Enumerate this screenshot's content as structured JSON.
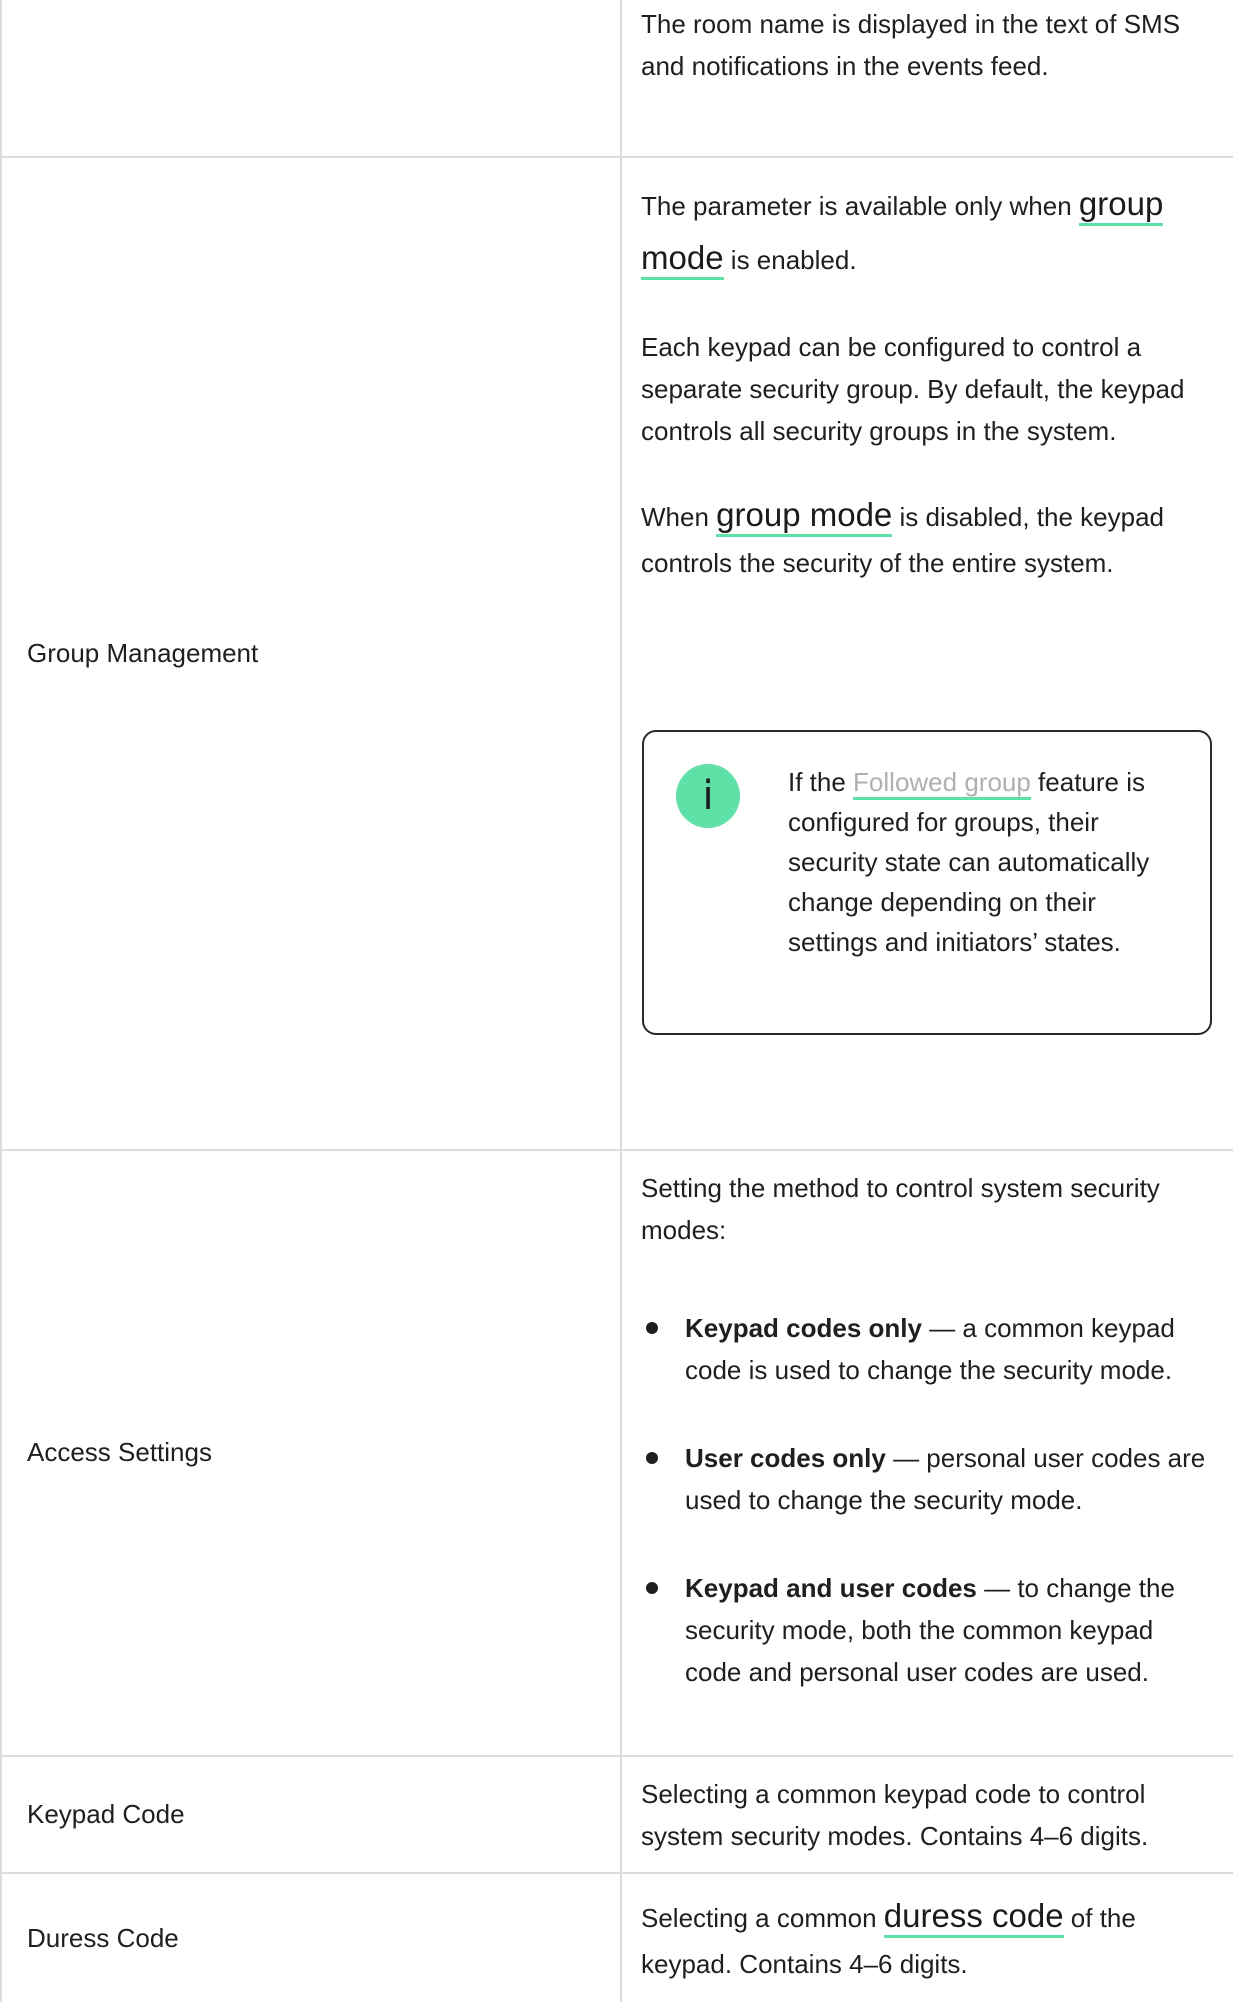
{
  "rows": {
    "room": {
      "description": "The room name is displayed in the text of SMS and notifications in the events feed."
    },
    "group_management": {
      "label": "Group Management",
      "p1_before": "The parameter is available only when ",
      "p1_link": "group mode",
      "p1_after": " is enabled.",
      "p2": "Each keypad can be configured to control a separate security group. By default, the keypad controls all security groups in the system.",
      "p3_before": "When ",
      "p3_link": "group mode",
      "p3_after": " is disabled, the keypad controls the security of the entire system.",
      "note": {
        "icon_glyph": "i",
        "before": "If the ",
        "link": "Followed group",
        "after": " feature is configured for groups, their security state can automatically change depending on their settings and initiators’ states."
      }
    },
    "access_settings": {
      "label": "Access Settings",
      "intro": "Setting the method to control system security modes:",
      "options": [
        {
          "name": "Keypad codes only",
          "desc": " — a common keypad code is used to change the security mode."
        },
        {
          "name": "User codes only",
          "desc": " — personal user codes are used to change the security mode."
        },
        {
          "name": "Keypad and user codes",
          "desc": " — to change the security mode, both the common keypad code and personal user codes are used."
        }
      ]
    },
    "keypad_code": {
      "label": "Keypad Code",
      "description": "Selecting a common keypad code to control system security modes. Contains 4–6 digits."
    },
    "duress_code": {
      "label": "Duress Code",
      "before": "Selecting a common ",
      "link": "duress code",
      "after": " of the keypad. Contains 4–6 digits."
    }
  },
  "colors": {
    "accent": "#5ee0a6",
    "border": "#dcdcdc",
    "text": "#1f1f1f",
    "muted_link": "#b0b0b0"
  }
}
